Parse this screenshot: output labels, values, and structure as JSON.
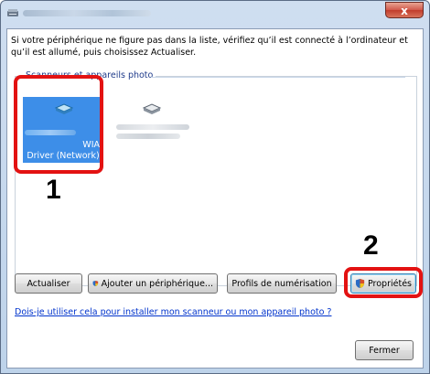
{
  "window": {
    "close_label": "x"
  },
  "instruction": "Si votre périphérique ne figure pas dans la liste, vérifiez qu’il est connecté à l’ordinateur et qu’il est allumé, puis choisissez Actualiser.",
  "device_group": {
    "title": "Scanneurs et appareils photo"
  },
  "devices": [
    {
      "label_line1": "WIA",
      "label_line2": "Driver (Network)",
      "selected": true,
      "icon": "scanner-icon"
    },
    {
      "label_line1": "",
      "label_line2": "",
      "selected": false,
      "icon": "scanner-icon"
    }
  ],
  "callouts": {
    "one": "1",
    "two": "2"
  },
  "buttons": {
    "refresh": "Actualiser",
    "add_device": "Ajouter un périphérique...",
    "scan_profiles": "Profils de numérisation",
    "properties": "Propriétés",
    "close": "Fermer"
  },
  "help_link": "Dois-je utiliser cela pour installer mon scanneur ou mon appareil photo ?",
  "colors": {
    "callout_red": "#e31212",
    "selection_blue": "#3d8ee8",
    "link_blue": "#0033cc"
  }
}
